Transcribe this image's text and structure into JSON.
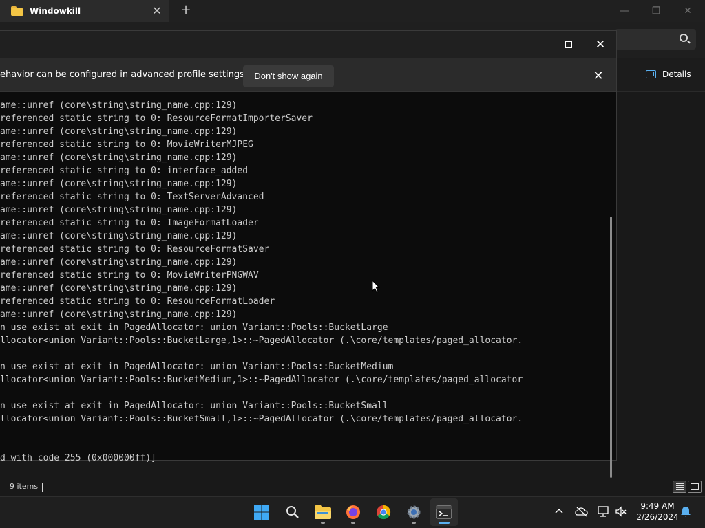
{
  "explorer": {
    "tab_title": "Windowkill",
    "status_items": "9 items",
    "details_label": "Details"
  },
  "terminal": {
    "banner_text": "ehavior can be configured in advanced profile settings.",
    "banner_button": "Don't show again",
    "output_lines": [
      "ame::unref (core\\string\\string_name.cpp:129)",
      "referenced static string to 0: ResourceFormatImporterSaver",
      "ame::unref (core\\string\\string_name.cpp:129)",
      "referenced static string to 0: MovieWriterMJPEG",
      "ame::unref (core\\string\\string_name.cpp:129)",
      "referenced static string to 0: interface_added",
      "ame::unref (core\\string\\string_name.cpp:129)",
      "referenced static string to 0: TextServerAdvanced",
      "ame::unref (core\\string\\string_name.cpp:129)",
      "referenced static string to 0: ImageFormatLoader",
      "ame::unref (core\\string\\string_name.cpp:129)",
      "referenced static string to 0: ResourceFormatSaver",
      "ame::unref (core\\string\\string_name.cpp:129)",
      "referenced static string to 0: MovieWriterPNGWAV",
      "ame::unref (core\\string\\string_name.cpp:129)",
      "referenced static string to 0: ResourceFormatLoader",
      "ame::unref (core\\string\\string_name.cpp:129)",
      "n use exist at exit in PagedAllocator: union Variant::Pools::BucketLarge",
      "llocator<union Variant::Pools::BucketLarge,1>::~PagedAllocator (.\\core/templates/paged_allocator.",
      "",
      "n use exist at exit in PagedAllocator: union Variant::Pools::BucketMedium",
      "llocator<union Variant::Pools::BucketMedium,1>::~PagedAllocator (.\\core/templates/paged_allocator",
      "",
      "n use exist at exit in PagedAllocator: union Variant::Pools::BucketSmall",
      "llocator<union Variant::Pools::BucketSmall,1>::~PagedAllocator (.\\core/templates/paged_allocator.",
      "",
      "",
      "d with code 255 (0x000000ff)]"
    ]
  },
  "taskbar": {
    "time": "9:49 AM",
    "date": "2/26/2024",
    "apps": [
      {
        "name": "start",
        "icon": "windows-logo-icon"
      },
      {
        "name": "search",
        "icon": "search-icon"
      },
      {
        "name": "file-explorer",
        "icon": "folder-icon"
      },
      {
        "name": "firefox",
        "icon": "firefox-icon"
      },
      {
        "name": "chrome",
        "icon": "chrome-icon"
      },
      {
        "name": "settings",
        "icon": "gear-icon"
      },
      {
        "name": "terminal",
        "icon": "terminal-icon"
      }
    ]
  },
  "colors": {
    "accent": "#5ab0f0",
    "terminal_bg": "#0c0c0c",
    "terminal_text": "#cccccc"
  }
}
